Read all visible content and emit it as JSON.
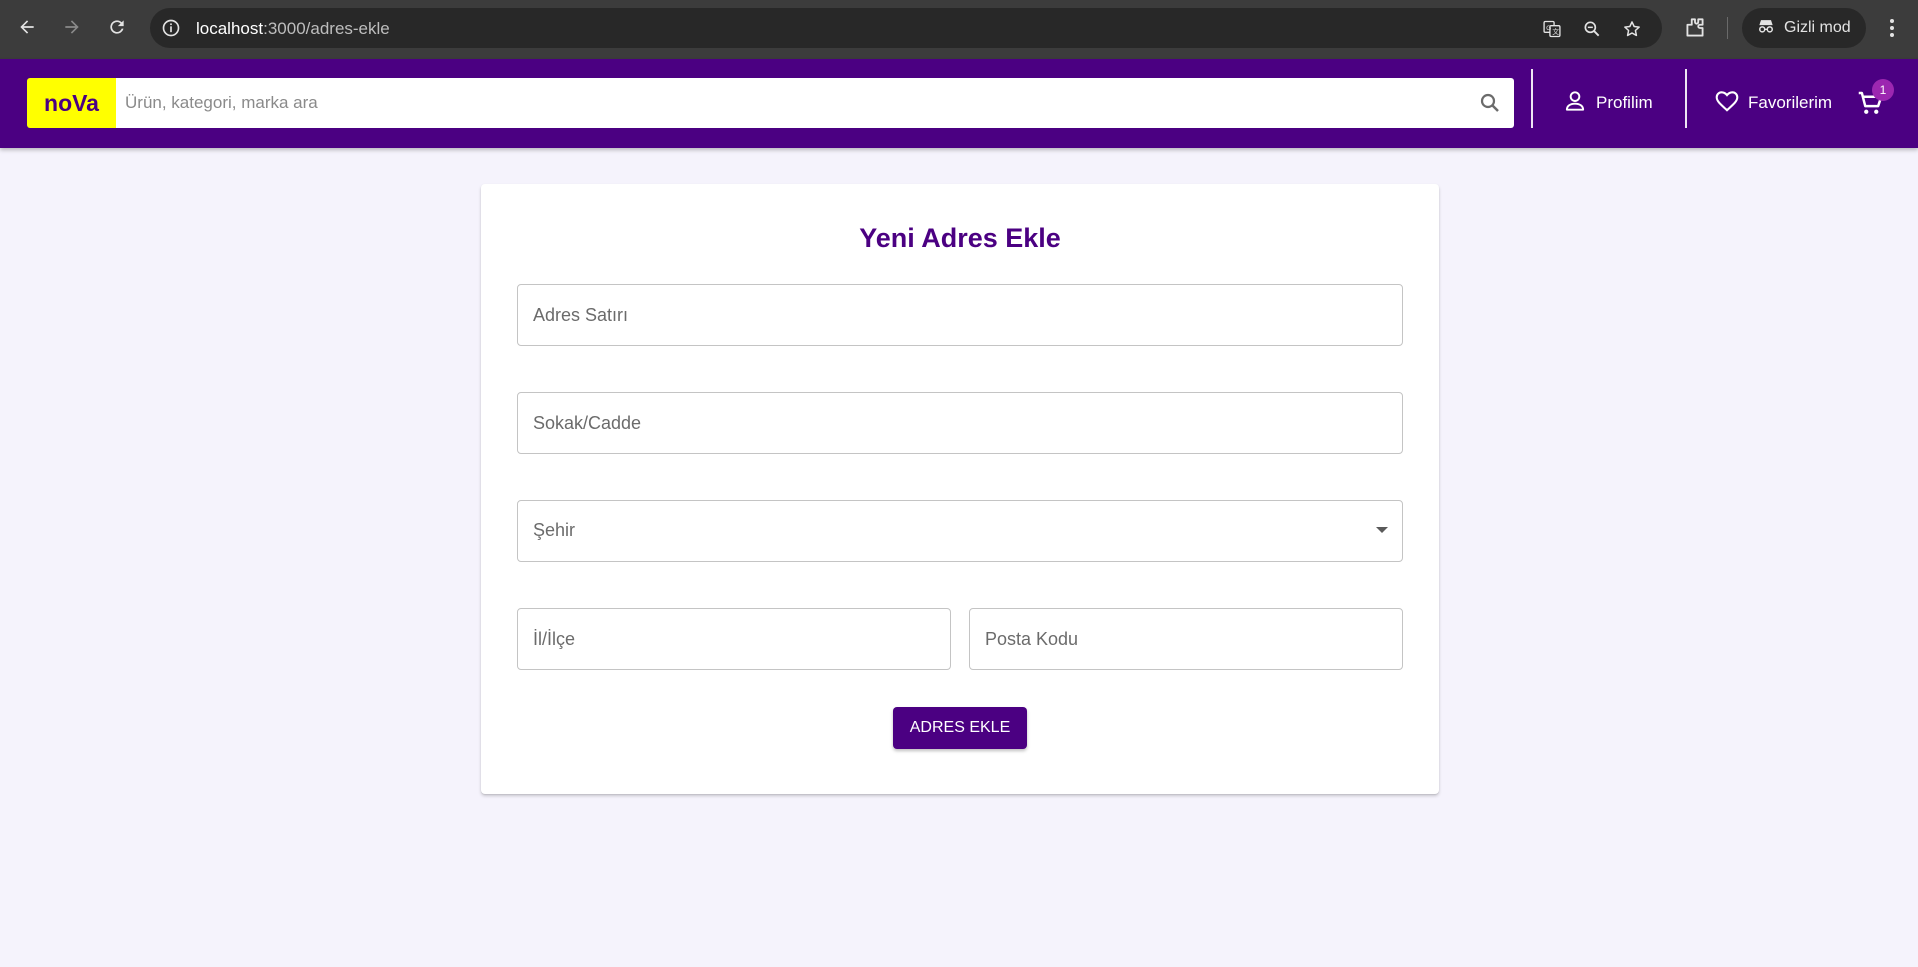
{
  "browser": {
    "url_host": "localhost",
    "url_path": ":3000/adres-ekle",
    "incognito_label": "Gizli mod",
    "icons": [
      "back-icon",
      "forward-icon",
      "reload-icon",
      "site-info-icon",
      "translate-icon",
      "zoom-icon",
      "bookmark-star-icon",
      "extensions-icon",
      "incognito-icon",
      "more-menu-icon"
    ]
  },
  "header": {
    "logo": "noVa",
    "search_placeholder": "Ürün, kategori, marka ara",
    "profile_label": "Profilim",
    "favorites_label": "Favorilerim",
    "cart_count": "1",
    "colors": {
      "brand": "#4b0082",
      "logo_bg": "#ffff00",
      "badge": "#9c27b0"
    }
  },
  "form": {
    "title": "Yeni Adres Ekle",
    "address_line_placeholder": "Adres Satırı",
    "street_placeholder": "Sokak/Cadde",
    "city_label": "Şehir",
    "district_placeholder": "İl/İlçe",
    "postal_code_placeholder": "Posta Kodu",
    "submit_label": "ADRES EKLE"
  }
}
